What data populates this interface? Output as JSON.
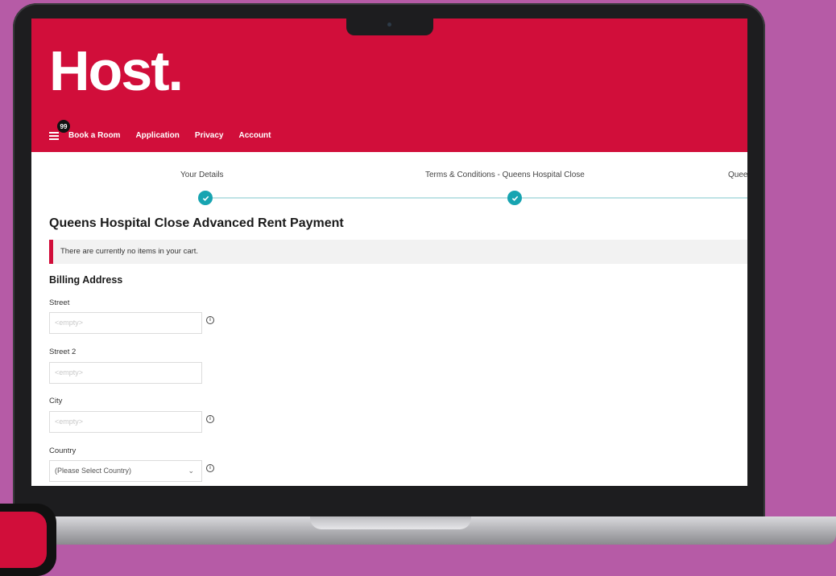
{
  "header": {
    "logo": "Host.",
    "cart_count": "99",
    "nav": [
      "Book a Room",
      "Application",
      "Privacy",
      "Account"
    ]
  },
  "steps": [
    {
      "label": "Your Details",
      "completed": true
    },
    {
      "label": "Terms & Conditions - Queens Hospital Close",
      "completed": true
    },
    {
      "label": "Quee",
      "completed": false
    }
  ],
  "page": {
    "title": "Queens Hospital Close Advanced Rent Payment",
    "alert": "There are currently no items in your cart.",
    "billing_title": "Billing Address"
  },
  "form": {
    "street_label": "Street",
    "street_placeholder": "<empty>",
    "street2_label": "Street 2",
    "street2_placeholder": "<empty>",
    "city_label": "City",
    "city_placeholder": "<empty>",
    "country_label": "Country",
    "country_value": "(Please Select Country)"
  },
  "icons": {
    "menu": "menu-icon",
    "check": "check-icon",
    "info": "info-icon",
    "chevron": "chevron-down-icon"
  },
  "colors": {
    "brand": "#d10e3a",
    "accent": "#17a4b1",
    "background": "#b65ba6"
  }
}
